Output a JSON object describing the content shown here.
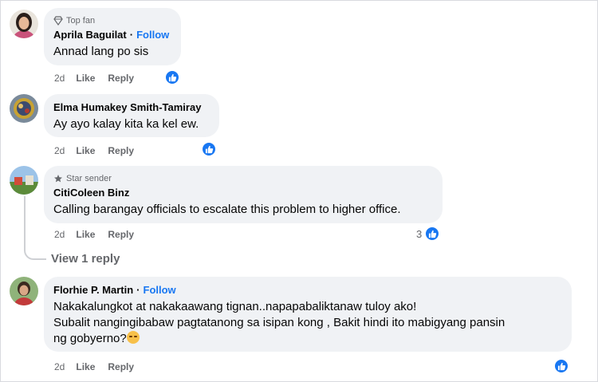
{
  "comments": [
    {
      "badge": "Top fan",
      "author": "Aprila Baguilat",
      "follow": "Follow",
      "text": "Annad lang po sis",
      "time": "2d",
      "like": "Like",
      "reply": "Reply"
    },
    {
      "author": "Elma Humakey Smith-Tamiray",
      "text": "Ay ayo kalay kita ka kel ew.",
      "time": "2d",
      "like": "Like",
      "reply": "Reply"
    },
    {
      "badge": "Star sender",
      "author": "CitiColeen Binz",
      "text": "Calling barangay officials to escalate this problem to higher office.",
      "time": "2d",
      "like": "Like",
      "reply": "Reply",
      "reaction_count": "3"
    },
    {
      "author": "Florhie P. Martin",
      "follow": "Follow",
      "text_lines": [
        "Nakakalungkot at nakakaawang tignan..napapabaliktanaw tuloy ako!",
        "Subalit nangingibabaw pagtatanong sa isipan kong , Bakit hindi ito mabigyang pansin",
        "ng gobyerno?"
      ],
      "time": "2d",
      "like": "Like",
      "reply": "Reply"
    }
  ],
  "view_replies": "View 1 reply",
  "separator": "·",
  "icons": {
    "badge1": "top-fan-icon",
    "badge3": "star-sender-icon",
    "reaction": "thumbs-up-icon",
    "emoji": "sad-face-emoji"
  },
  "colors": {
    "accent": "#1877f2",
    "bubble": "#f0f2f5",
    "meta": "#65676b"
  }
}
